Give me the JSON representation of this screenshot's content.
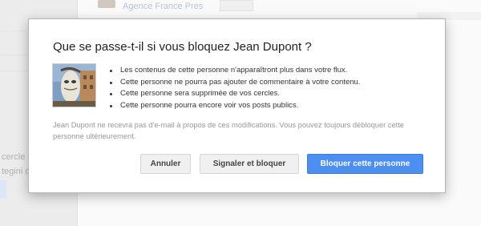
{
  "background": {
    "agency_name": "Agence France Pres",
    "left_texts": [
      "cercle a",
      "tegini ot"
    ]
  },
  "dialog": {
    "title": "Que se passe-t-il si vous bloquez Jean Dupont ?",
    "bullets": [
      "Les contenus de cette personne n'apparaîtront plus dans votre flux.",
      "Cette personne ne pourra pas ajouter de commentaire à votre contenu.",
      "Cette personne sera supprimée de vos cercles.",
      "Cette personne pourra encore voir vos posts publics."
    ],
    "note": "Jean Dupont ne recevra pas d'e-mail à propos de ces modifications. Vous pouvez toujours débloquer cette personne ultérieurement.",
    "buttons": {
      "cancel": "Annuler",
      "report_block": "Signaler et bloquer",
      "block": "Bloquer cette personne"
    }
  },
  "colors": {
    "primary_button": "#4d8ef1",
    "title_text": "#222222",
    "note_text": "#999999"
  },
  "icons": {
    "profile_thumbnail": "profile-photo"
  }
}
